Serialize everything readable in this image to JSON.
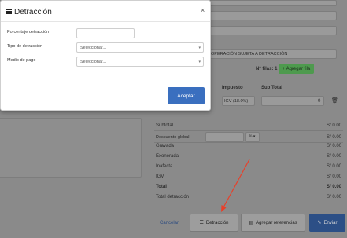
{
  "modal": {
    "title": "Detracción",
    "close": "×",
    "fields": {
      "porcentaje_label": "Porcentaje detracción",
      "porcentaje_value": "",
      "tipo_label": "Tipo de detracción",
      "tipo_placeholder": "Seleccionar...",
      "medio_label": "Medio de pago",
      "medio_placeholder": "Seleccionar..."
    },
    "accept_label": "Aceptar"
  },
  "background": {
    "operation_text": "OPERACIÓN SUJETA A DETRACCIÓN",
    "rows_label": "N° filas: 1",
    "add_row_label": "+ Agregar fila",
    "columns": {
      "impuesto": "Impuesto",
      "subtotal": "Sub Total"
    },
    "row": {
      "impuesto_value": "IGV (18.0%)",
      "subtotal_value": "0"
    },
    "discount_label": "Descuento global",
    "discount_unit": "% ▾",
    "summary": [
      {
        "label": "Subtotal",
        "value": "S/ 0.00",
        "bold": false
      },
      {
        "label": "Gravada",
        "value": "S/ 0.00",
        "bold": false
      },
      {
        "label": "Exonerada",
        "value": "S/ 0.00",
        "bold": false
      },
      {
        "label": "Inafecta",
        "value": "S/ 0.00",
        "bold": false
      },
      {
        "label": "IGV",
        "value": "S/ 0.00",
        "bold": false
      },
      {
        "label": "Total",
        "value": "S/ 0.00",
        "bold": true
      },
      {
        "label": "Total detracción",
        "value": "S/ 0.00",
        "bold": false
      }
    ],
    "discount_value": "S/ 0.00",
    "footer": {
      "cancel": "Cancelar",
      "detraccion": "Detracción",
      "referencias": "Agregar referencias",
      "enviar": "Enviar"
    }
  },
  "colors": {
    "primary": "#3a6fbf",
    "green": "#4e9a4e",
    "annotation_arrow": "#e8402a"
  }
}
